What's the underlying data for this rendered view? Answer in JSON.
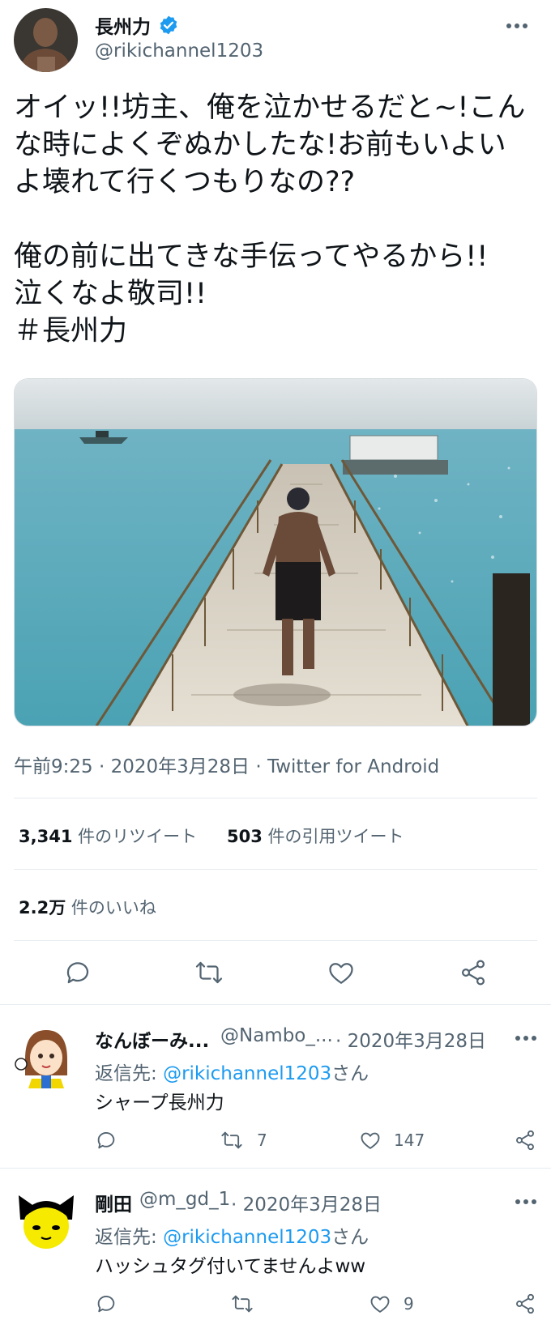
{
  "author": {
    "name": "長州力",
    "handle": "@rikichannel1203"
  },
  "tweet": {
    "text": "オイッ!!坊主、俺を泣かせるだと~!こんな時によくぞぬかしたな!お前もいよいよ壊れて行くつもりなの??\n\n俺の前に出てきな手伝ってやるから!!\n泣くなよ敬司!!\n＃長州力",
    "time": "午前9:25",
    "date": "2020年3月28日",
    "source": "Twitter for Android",
    "meta_sep": "·"
  },
  "stats": {
    "retweets_count": "3,341",
    "retweets_label": "件のリツイート",
    "quotes_count": "503",
    "quotes_label": "件の引用ツイート",
    "likes_count": "2.2万",
    "likes_label": "件のいいね"
  },
  "replies": [
    {
      "name": "なんぼーみ...",
      "handle": "@Nambo_...",
      "date": "· 2020年3月28日",
      "reply_to_label": "返信先:",
      "reply_to_mention": "@rikichannel1203",
      "reply_to_suffix": "さん",
      "text": "シャープ長州力",
      "retweets": "7",
      "likes": "147"
    },
    {
      "name": "剛田",
      "handle": "@m_gd_1",
      "date": "· 2020年3月28日",
      "reply_to_label": "返信先:",
      "reply_to_mention": "@rikichannel1203",
      "reply_to_suffix": "さん",
      "text": "ハッシュタグ付いてませんよww",
      "retweets": "",
      "likes": "9"
    }
  ],
  "colors": {
    "accent": "#1d9bf0",
    "text_primary": "#0f1419",
    "text_secondary": "#536471",
    "divider": "#e6ecf0"
  },
  "icons": [
    "verified-badge-icon",
    "more-options-icon",
    "reply-icon",
    "retweet-icon",
    "like-icon",
    "share-icon"
  ]
}
